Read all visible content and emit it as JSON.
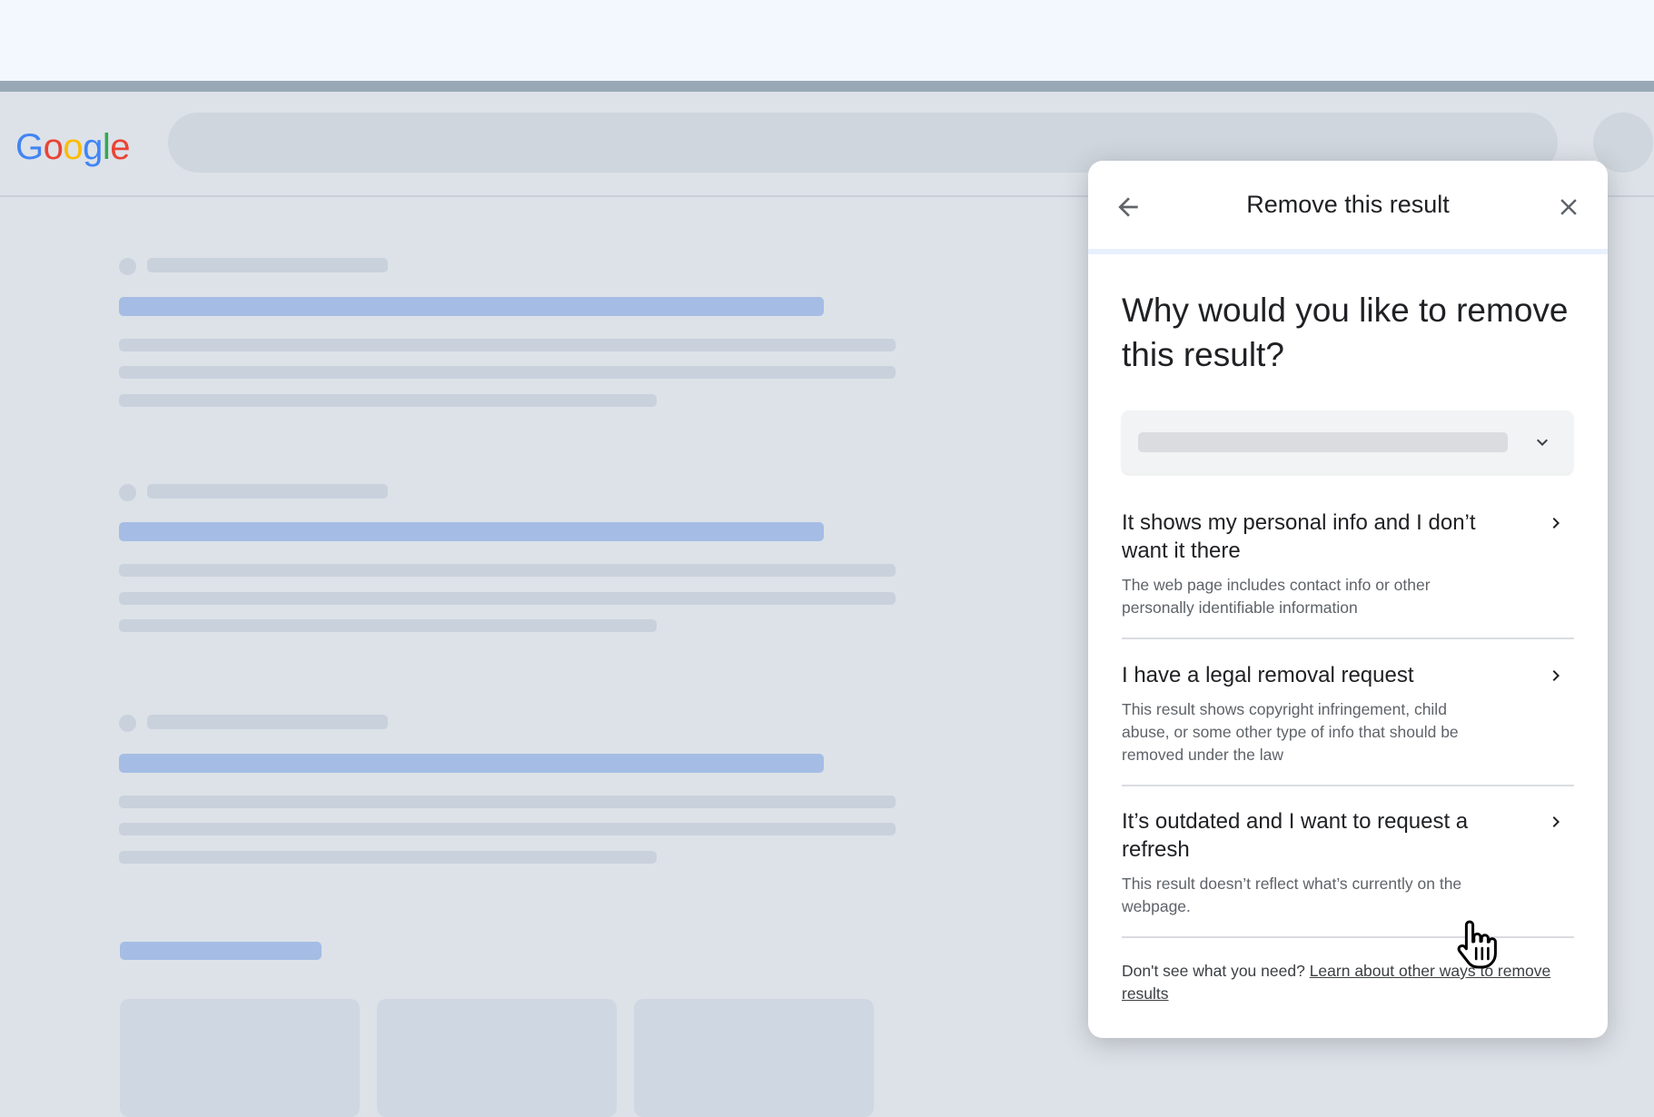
{
  "logo": {
    "letters": [
      "G",
      "o",
      "o",
      "g",
      "l",
      "e"
    ],
    "colors": [
      "#4285F4",
      "#EA4335",
      "#FBBC05",
      "#4285F4",
      "#34A853",
      "#EA4335"
    ]
  },
  "panel": {
    "title": "Remove this result",
    "back_icon": "arrow-back-icon",
    "close_icon": "close-icon",
    "question": "Why would you like to remove this result?",
    "options": [
      {
        "title": "It shows my personal info and I don’t want it there",
        "description": "The web page includes contact info or other personally identifiable information"
      },
      {
        "title": "I have a legal removal request",
        "description": "This result shows copyright infringement, child abuse, or some other type of info that should be removed under the law"
      },
      {
        "title": "It’s outdated and I want to request a refresh",
        "description": "This result doesn’t reflect what’s currently on the webpage."
      }
    ],
    "footer_text": "Don't see what you need?",
    "footer_link": "Learn about other ways to remove results"
  },
  "colors": {
    "accent_title_skeleton": "#a5bde4",
    "skeleton": "#c9d1dc",
    "background": "#dde2e8",
    "divider_tint": "#e8f0fe"
  }
}
